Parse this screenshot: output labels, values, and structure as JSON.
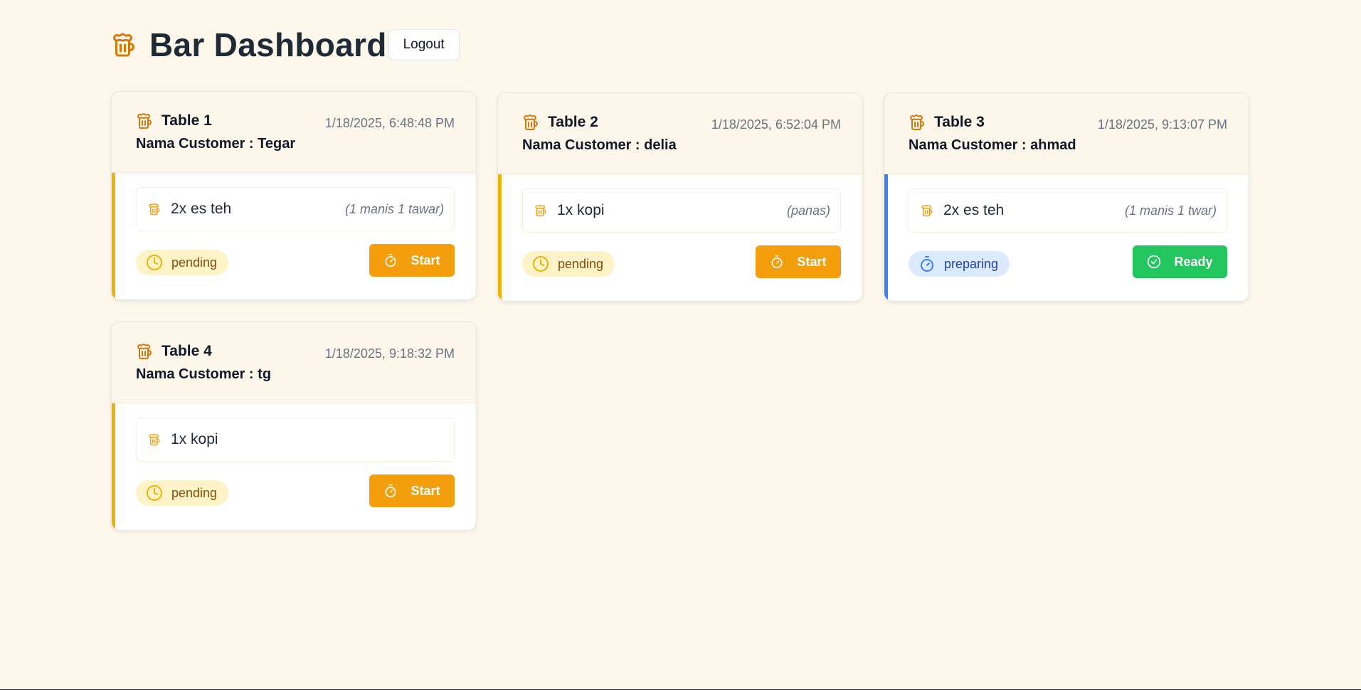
{
  "header": {
    "title": "Bar Dashboard",
    "logout_label": "Logout",
    "logo_icon": "beer-mug-icon"
  },
  "colors": {
    "pending_accent": "#eab308",
    "preparing_accent": "#3b82f6",
    "start_button": "#f59e0b",
    "ready_button": "#22c55e",
    "icon_orange": "#d97706"
  },
  "orders": [
    {
      "table": "Table 1",
      "timestamp": "1/18/2025, 6:48:48 PM",
      "customer": "Nama Customer : Tegar",
      "item": "2x es teh",
      "note": "(1 manis 1 tawar)",
      "status": "pending",
      "action": "Start"
    },
    {
      "table": "Table 2",
      "timestamp": "1/18/2025, 6:52:04 PM",
      "customer": "Nama Customer : delia",
      "item": "1x kopi",
      "note": "(panas)",
      "status": "pending",
      "action": "Start"
    },
    {
      "table": "Table 3",
      "timestamp": "1/18/2025, 9:13:07 PM",
      "customer": "Nama Customer : ahmad",
      "item": "2x es teh",
      "note": "(1 manis 1 twar)",
      "status": "preparing",
      "action": "Ready"
    },
    {
      "table": "Table 4",
      "timestamp": "1/18/2025, 9:18:32 PM",
      "customer": "Nama Customer : tg",
      "item": "1x kopi",
      "note": "",
      "status": "pending",
      "action": "Start"
    }
  ]
}
